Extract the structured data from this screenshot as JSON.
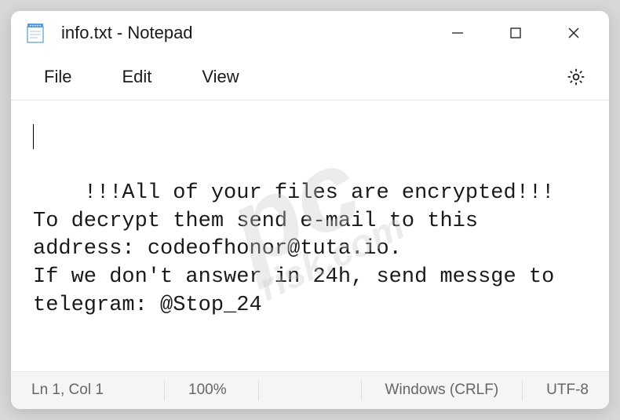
{
  "window": {
    "title": "info.txt - Notepad"
  },
  "menu": {
    "file": "File",
    "edit": "Edit",
    "view": "View"
  },
  "content": {
    "text": "!!!All of your files are encrypted!!!\nTo decrypt them send e-mail to this address: codeofhonor@tuta.io.\nIf we don't answer in 24h, send messge to telegram: @Stop_24"
  },
  "status": {
    "position": "Ln 1, Col 1",
    "zoom": "100%",
    "line_ending": "Windows (CRLF)",
    "encoding": "UTF-8"
  },
  "watermark": {
    "main": "pc",
    "sub": "risk.com"
  }
}
